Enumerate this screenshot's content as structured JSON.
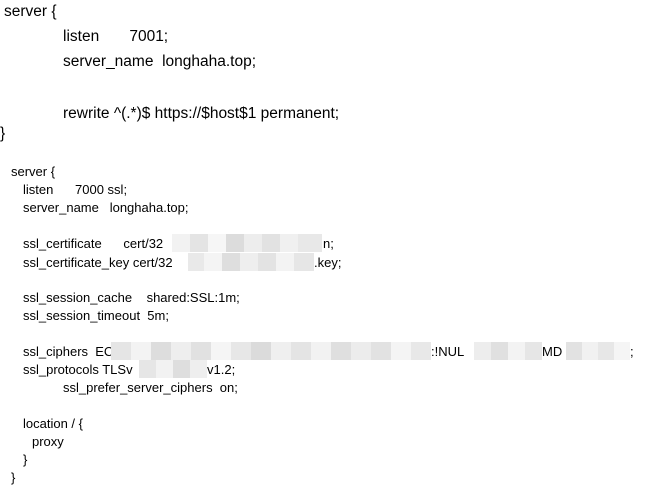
{
  "block1": {
    "open": "server {",
    "listen": "listen       7001;",
    "server_name": "server_name  longhaha.top;",
    "rewrite": "rewrite ^(.*)$ https://$host$1 permanent;",
    "close": "}"
  },
  "block2": {
    "open": "server {",
    "listen": "listen      7000 ssl;",
    "server_name": "server_name   longhaha.top;",
    "ssl_certificate_prefix": "ssl_certificate      cert/32",
    "ssl_certificate_suffix": "n;",
    "ssl_certificate_key_prefix": "ssl_certificate_key cert/32",
    "ssl_certificate_key_suffix": ".key;",
    "ssl_session_cache": "ssl_session_cache    shared:SSL:1m;",
    "ssl_session_timeout": "ssl_session_timeout  5m;",
    "ssl_ciphers_prefix": "ssl_ciphers  EC",
    "ssl_ciphers_middle1": ":!NUL",
    "ssl_ciphers_middle2": "MD",
    "ssl_ciphers_suffix": ";",
    "ssl_protocols_prefix": "ssl_protocols TLSv",
    "ssl_protocols_suffix": "v1.2;",
    "ssl_prefer_server_ciphers": "ssl_prefer_server_ciphers  on;",
    "location_open": "location / {",
    "proxy": "proxy",
    "location_close": "}",
    "close": "}"
  },
  "colors": {
    "text": "#000000",
    "background": "#ffffff",
    "redaction_light": "#f1f1f1",
    "redaction_mid": "#e6e6e6",
    "redaction_dark": "#dadada"
  }
}
